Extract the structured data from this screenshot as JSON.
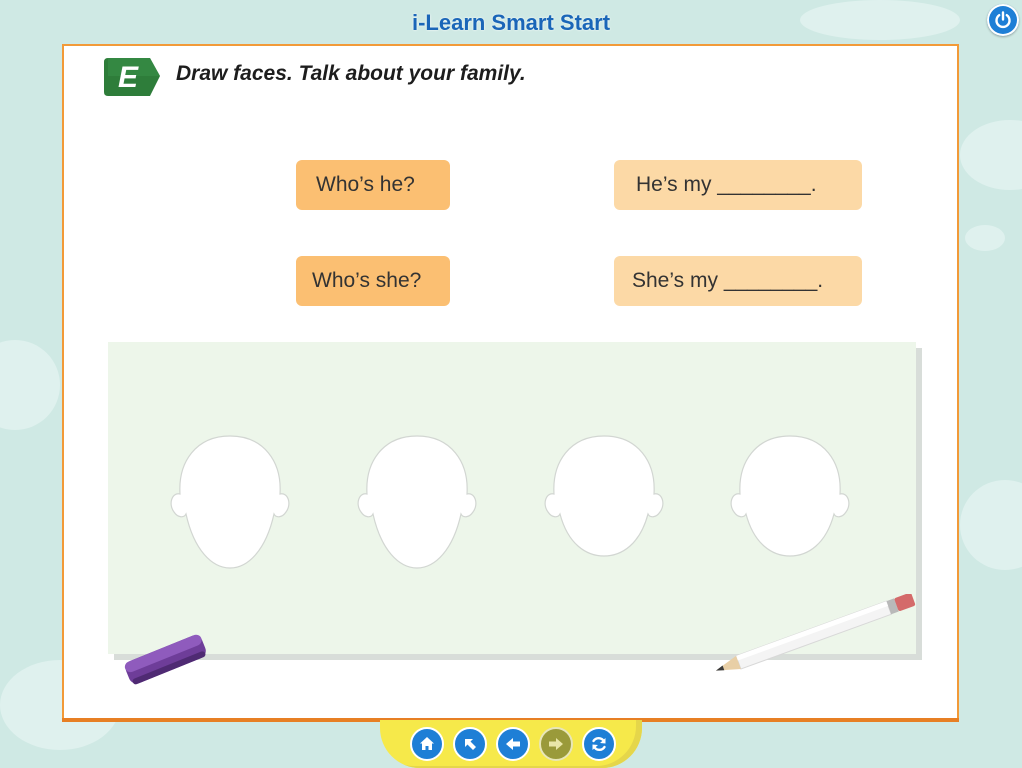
{
  "app": {
    "title": "i-Learn Smart Start"
  },
  "exercise": {
    "badge_letter": "E",
    "instruction": "Draw faces. Talk about your family."
  },
  "bubbles": {
    "q1": "Who’s he?",
    "a1": "He’s my ________.",
    "q2": "Who’s she?",
    "a2": "She’s my ________."
  },
  "faces": [
    "face-1",
    "face-2",
    "face-3",
    "face-4"
  ],
  "icons": {
    "power": "power-icon",
    "home": "home-icon",
    "up": "arrow-up-left-icon",
    "back": "arrow-left-icon",
    "next": "arrow-right-icon",
    "refresh": "refresh-icon"
  },
  "colors": {
    "accent": "#1e7fd6",
    "page_border": "#f29a38",
    "question_bubble": "#fbbf72",
    "answer_bubble": "#fcd9a6",
    "badge": "#2e7d3a",
    "board": "#edf6ea",
    "nav_bar": "#f6e94a",
    "nav_active": "#1e7fd6",
    "nav_disabled": "#9a9a3a"
  }
}
